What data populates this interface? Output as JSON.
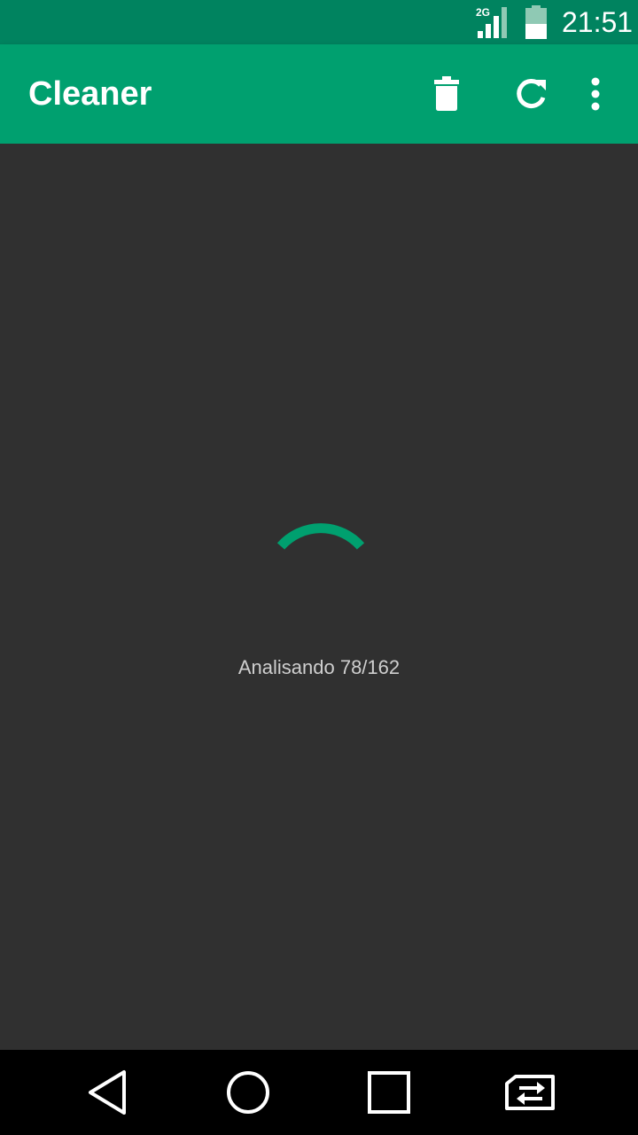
{
  "status_bar": {
    "network_type": "2G",
    "time": "21:51",
    "signal_icon": "signal-icon",
    "battery_icon": "battery-icon",
    "battery_level": 0.5
  },
  "app_bar": {
    "title": "Cleaner",
    "actions": [
      {
        "name": "delete",
        "icon": "trash-icon"
      },
      {
        "name": "refresh",
        "icon": "refresh-icon"
      },
      {
        "name": "more",
        "icon": "more-vert-icon"
      }
    ]
  },
  "content": {
    "progress_text": "Analisando 78/162",
    "progress_current": 78,
    "progress_total": 162
  },
  "nav_bar": {
    "buttons": [
      "back-icon",
      "home-icon",
      "recents-icon",
      "switch-sim-icon"
    ]
  },
  "colors": {
    "status_bar": "#00835F",
    "app_bar": "#00A06F",
    "background": "#303030",
    "accent": "#00A06F",
    "nav_bar": "#000000"
  }
}
